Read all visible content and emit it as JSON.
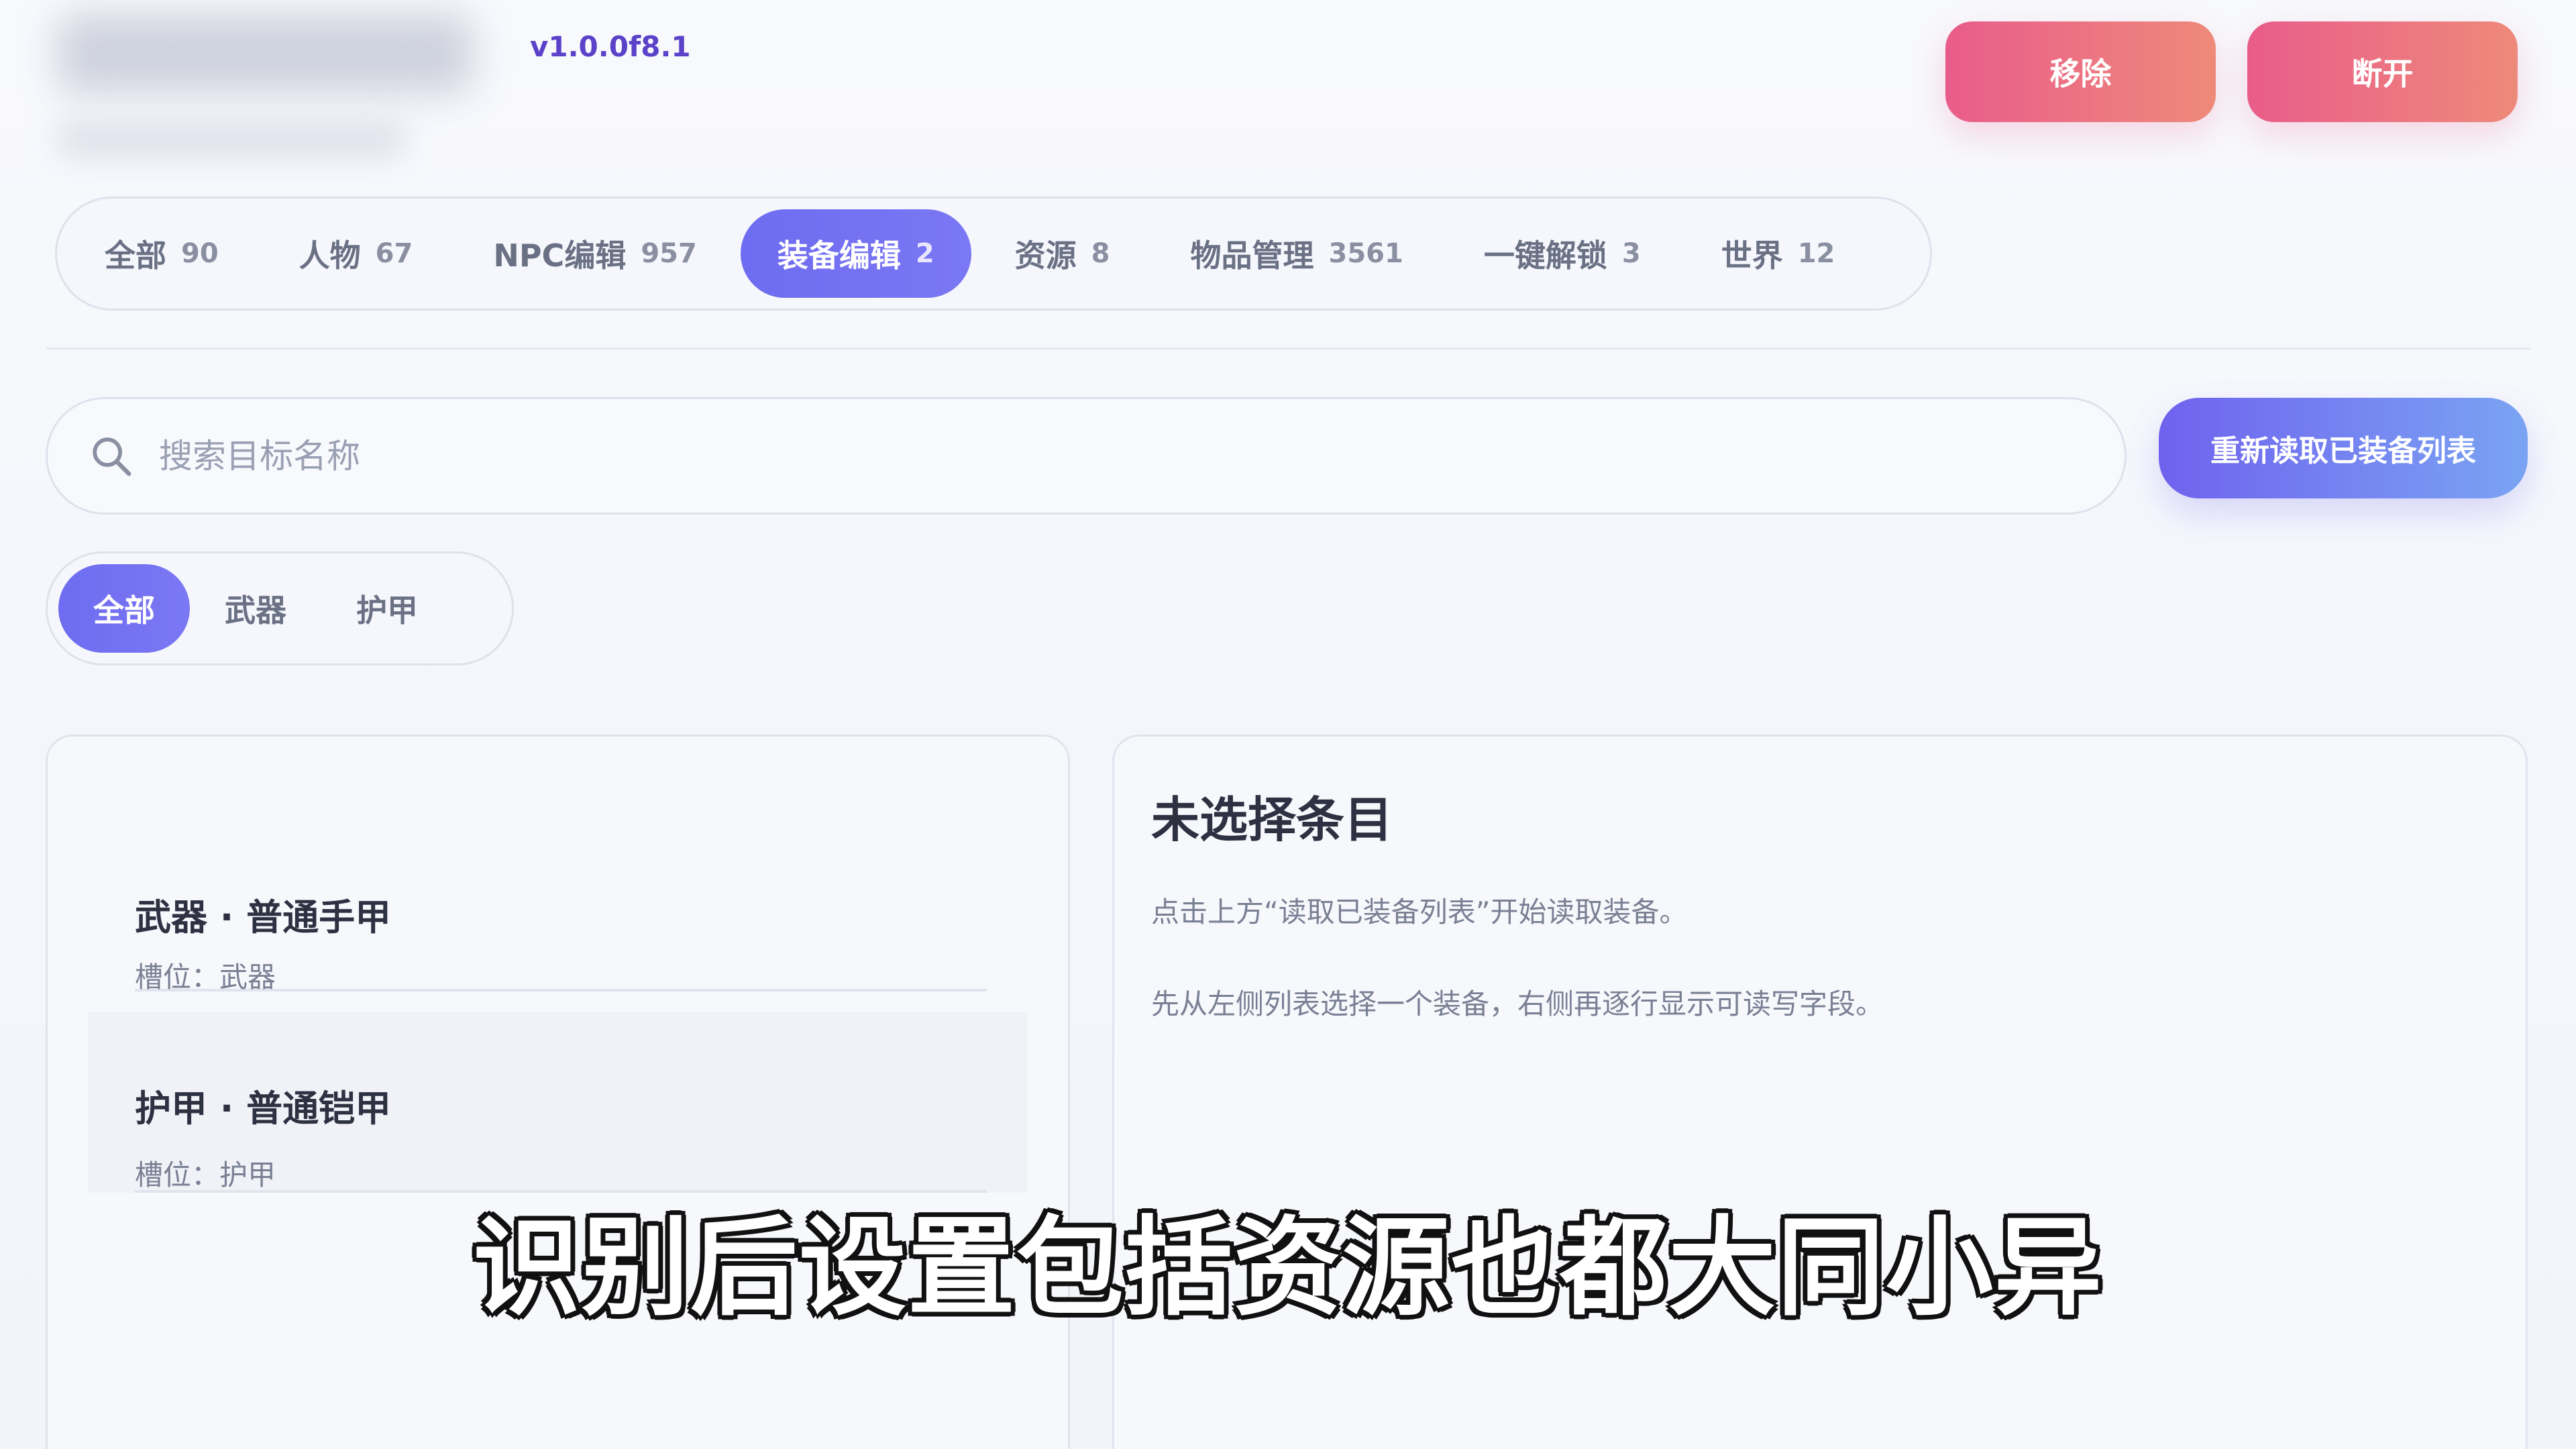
{
  "header": {
    "version": "v1.0.0f8.1",
    "remove_label": "移除",
    "disconnect_label": "断开"
  },
  "tabs": [
    {
      "label": "全部",
      "count": "90"
    },
    {
      "label": "人物",
      "count": "67"
    },
    {
      "label": "NPC编辑",
      "count": "957"
    },
    {
      "label": "装备编辑",
      "count": "2",
      "active": true
    },
    {
      "label": "资源",
      "count": "8"
    },
    {
      "label": "物品管理",
      "count": "3561"
    },
    {
      "label": "一键解锁",
      "count": "3"
    },
    {
      "label": "世界",
      "count": "12"
    }
  ],
  "search": {
    "placeholder": "搜索目标名称",
    "reload_label": "重新读取已装备列表"
  },
  "filter": {
    "items": [
      "全部",
      "武器",
      "护甲"
    ],
    "active": "全部"
  },
  "list": {
    "items": [
      {
        "title": "武器 · 普通手甲",
        "slot": "槽位：武器"
      },
      {
        "title": "护甲 · 普通铠甲",
        "slot": "槽位：护甲"
      }
    ]
  },
  "detail": {
    "title": "未选择条目",
    "p1": "点击上方“读取已装备列表”开始读取装备。",
    "p2": "先从左侧列表选择一个装备，右侧再逐行显示可读写字段。"
  },
  "caption": "识别后设置包括资源也都大同小异",
  "colors": {
    "accent": "#6e6cf0",
    "danger_gradient_start": "#e95c8a",
    "danger_gradient_end": "#ee8a7a",
    "reload_gradient_end": "#7aa4f3"
  }
}
